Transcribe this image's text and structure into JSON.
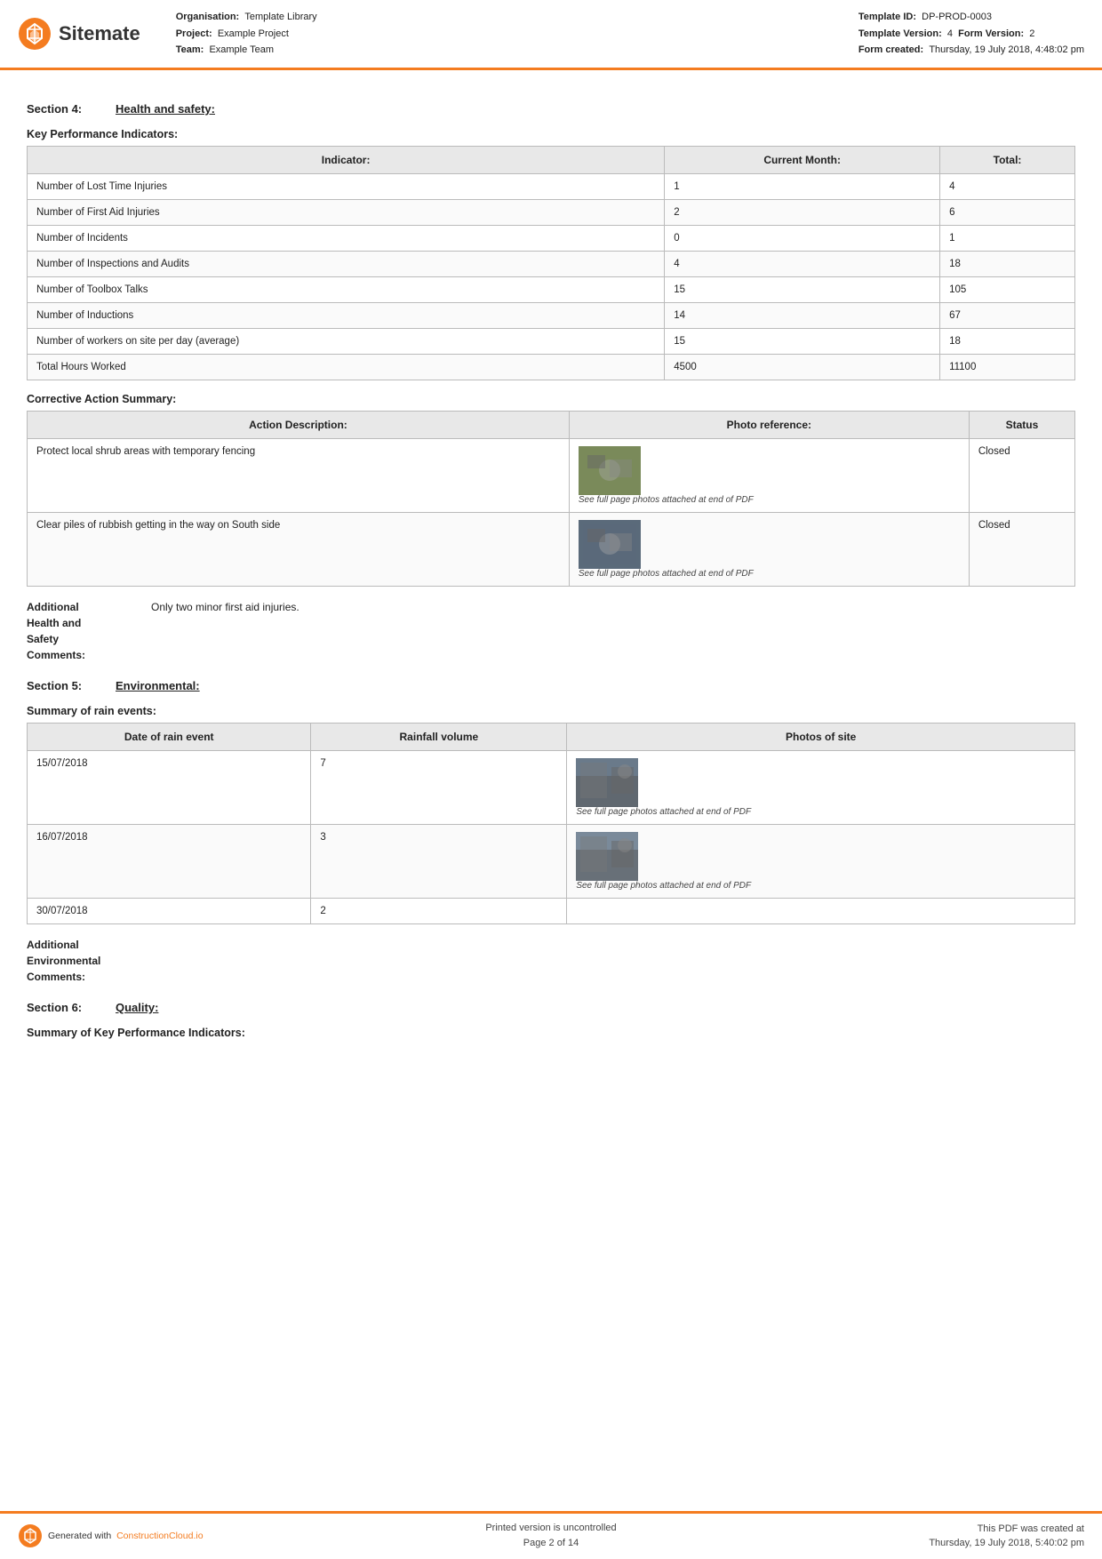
{
  "header": {
    "logo_text": "Sitemate",
    "org_label": "Organisation:",
    "org_value": "Template Library",
    "project_label": "Project:",
    "project_value": "Example Project",
    "team_label": "Team:",
    "team_value": "Example Team",
    "template_id_label": "Template ID:",
    "template_id_value": "DP-PROD-0003",
    "template_version_label": "Template Version:",
    "template_version_value": "4",
    "form_version_label": "Form Version:",
    "form_version_value": "2",
    "form_created_label": "Form created:",
    "form_created_value": "Thursday, 19 July 2018, 4:48:02 pm"
  },
  "sections": {
    "section4": {
      "number": "Section 4:",
      "title": "Health and safety:"
    },
    "section5": {
      "number": "Section 5:",
      "title": "Environmental:"
    },
    "section6": {
      "number": "Section 6:",
      "title": "Quality:"
    }
  },
  "kpi_table": {
    "title": "Key Performance Indicators:",
    "headers": [
      "Indicator:",
      "Current Month:",
      "Total:"
    ],
    "rows": [
      {
        "indicator": "Number of Lost Time Injuries",
        "current_month": "1",
        "total": "4"
      },
      {
        "indicator": "Number of First Aid Injuries",
        "current_month": "2",
        "total": "6"
      },
      {
        "indicator": "Number of Incidents",
        "current_month": "0",
        "total": "1"
      },
      {
        "indicator": "Number of Inspections and Audits",
        "current_month": "4",
        "total": "18"
      },
      {
        "indicator": "Number of Toolbox Talks",
        "current_month": "15",
        "total": "105"
      },
      {
        "indicator": "Number of Inductions",
        "current_month": "14",
        "total": "67"
      },
      {
        "indicator": "Number of workers on site per day (average)",
        "current_month": "15",
        "total": "18"
      },
      {
        "indicator": "Total Hours Worked",
        "current_month": "4500",
        "total": "11100"
      }
    ]
  },
  "corrective_action_table": {
    "title": "Corrective Action Summary:",
    "headers": [
      "Action Description:",
      "Photo reference:",
      "Status"
    ],
    "rows": [
      {
        "description": "Protect local shrub areas with temporary fencing",
        "photo_caption": "See full page photos attached at end of PDF",
        "status": "Closed"
      },
      {
        "description": "Clear piles of rubbish getting in the way on South side",
        "photo_caption": "See full page photos attached at end of PDF",
        "status": "Closed"
      }
    ]
  },
  "health_safety_comments": {
    "label": "Additional\nHealth and\nSafety\nComments:",
    "text": "Only two minor first aid injuries."
  },
  "rain_events_table": {
    "title": "Summary of rain events:",
    "headers": [
      "Date of rain event",
      "Rainfall volume",
      "Photos of site"
    ],
    "rows": [
      {
        "date": "15/07/2018",
        "volume": "7",
        "has_photo": true,
        "photo_caption": "See full page photos attached at end of PDF"
      },
      {
        "date": "16/07/2018",
        "volume": "3",
        "has_photo": true,
        "photo_caption": "See full page photos attached at end of PDF"
      },
      {
        "date": "30/07/2018",
        "volume": "2",
        "has_photo": false,
        "photo_caption": ""
      }
    ]
  },
  "environmental_comments": {
    "label": "Additional\nEnvironmental\nComments:",
    "text": ""
  },
  "quality_kpi_title": "Summary of Key Performance Indicators:",
  "footer": {
    "generated_text": "Generated with",
    "generated_link": "ConstructionCloud.io",
    "uncontrolled": "Printed version is uncontrolled",
    "page_info": "Page 2 of 14",
    "pdf_created": "This PDF was created at",
    "pdf_datetime": "Thursday, 19 July 2018, 5:40:02 pm"
  }
}
